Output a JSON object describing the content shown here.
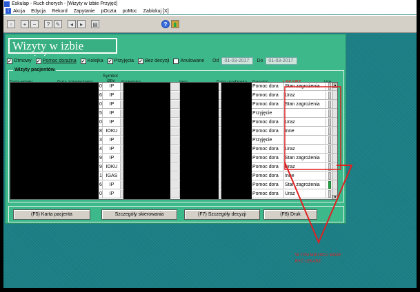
{
  "window_title": "Eskulap - Ruch chorych - [Wizyty  w  Izbie Przyjęć]",
  "menu": [
    "Akcja",
    "Edycja",
    "Rekord",
    "Zapytanie",
    "pOczta",
    "poMoc",
    "Zablokuj [X]"
  ],
  "form_title": "Wizyty w izbie przyjęć",
  "filters": {
    "checkboxes": [
      {
        "label": "Otmowy",
        "checked": true
      },
      {
        "label": "Pomoc doraźna",
        "checked": true
      },
      {
        "label": "Kolejka",
        "checked": true
      },
      {
        "label": "Przyjęcia",
        "checked": true
      },
      {
        "label": "Bez decyzji",
        "checked": true
      },
      {
        "label": "Anulowane",
        "checked": false
      }
    ],
    "od_label": "Od",
    "od_value": "01-03-2017",
    "do_label": "Do",
    "do_value": "01-03-2017"
  },
  "group_title": "Wizyty pacjentów",
  "columns": {
    "data_wizyty": "Data wizyty",
    "data_zakonczenia": "Data zakończenia",
    "symbol_izby_1": "Symbol",
    "symbol_izby_2": "izby",
    "nazwisko": "Nazwisko",
    "imie": "Imię",
    "data_urodzenia": "Data urodzenia",
    "decyzja": "Decyzja",
    "lekarz": "LEKARZ",
    "upr": "Upr"
  },
  "rows": [
    {
      "num": "0",
      "symbol": "IP",
      "decyzja": "Pomoc dora",
      "extra": "Stan zagrożenia"
    },
    {
      "num": "6",
      "symbol": "IP",
      "decyzja": "Pomoc dora",
      "extra": "Uraz"
    },
    {
      "num": "0",
      "symbol": "IP",
      "decyzja": "Pomoc dora",
      "extra": "Stan zagrożenia"
    },
    {
      "num": "5",
      "symbol": "IP",
      "decyzja": "Przyjęcie",
      "extra": ""
    },
    {
      "num": "0",
      "symbol": "IP",
      "decyzja": "Pomoc dora",
      "extra": "Uraz"
    },
    {
      "num": "8",
      "symbol": "IOKU",
      "decyzja": "Pomoc dora",
      "extra": "Inne"
    },
    {
      "num": "3",
      "symbol": "IP",
      "decyzja": "Przyjęcie",
      "extra": ""
    },
    {
      "num": "4",
      "symbol": "IP",
      "decyzja": "Pomoc dora",
      "extra": "Uraz"
    },
    {
      "num": "9",
      "symbol": "IP",
      "decyzja": "Pomoc dora",
      "extra": "Stan zagrożenia"
    },
    {
      "num": "9",
      "symbol": "IOKU",
      "decyzja": "Pomoc dora",
      "extra": "Uraz"
    },
    {
      "num": "1",
      "symbol": "IGAS",
      "decyzja": "Pomoc dora",
      "extra": "Inne"
    },
    {
      "num": "6",
      "symbol": "IP",
      "decyzja": "Pomoc dora",
      "extra": "Stan zagrożenia"
    },
    {
      "num": "0",
      "symbol": "IP",
      "decyzja": "Pomoc dora",
      "extra": "Uraz"
    }
  ],
  "buttons": {
    "karta": "(F5) Karta pacjenta",
    "skierowania": "Szczegóły skierowania",
    "decyzji": "(F7) Szczegóły decyzji",
    "druk": "(F8)  Druk"
  },
  "annotation_note": "W TYM MIEJSCU MOZE BYĆ LEKARZ",
  "colors": {
    "window_bg": "#3db88a",
    "desktop_bg": "#1a7f86",
    "annotation": "#e02020",
    "lekarz_header": "#e02020"
  }
}
